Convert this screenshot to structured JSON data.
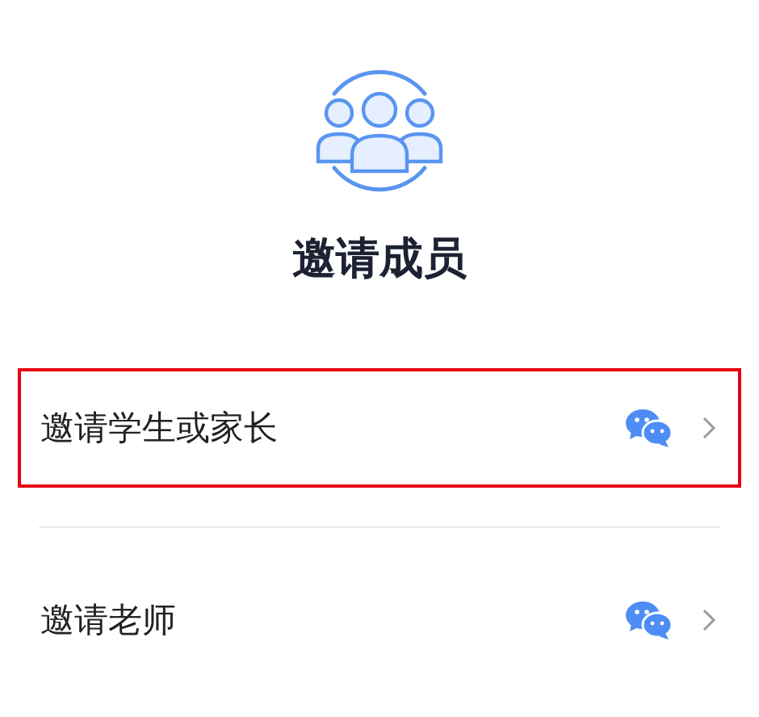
{
  "title": "邀请成员",
  "options": [
    {
      "label": "邀请学生或家长",
      "selected": true
    },
    {
      "label": "邀请老师",
      "selected": false
    }
  ]
}
